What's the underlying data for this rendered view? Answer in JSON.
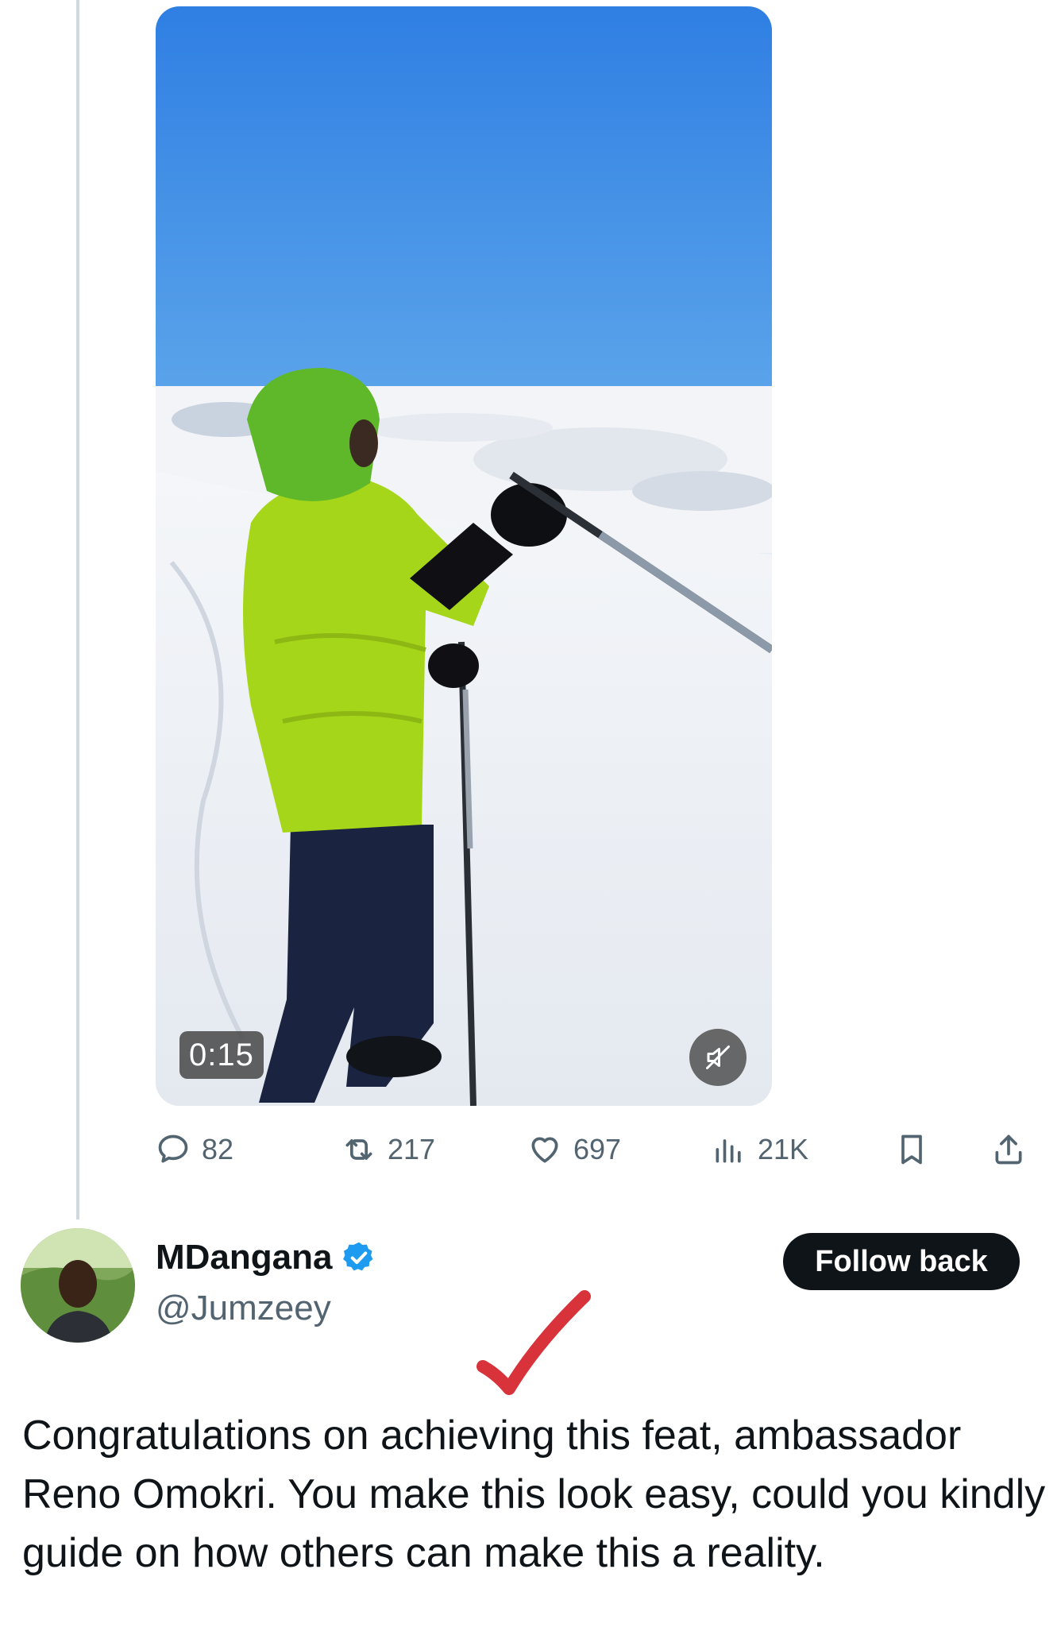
{
  "video": {
    "duration": "0:15"
  },
  "actions": {
    "replies": "82",
    "reposts": "217",
    "likes": "697",
    "views": "21K"
  },
  "reply": {
    "display_name": "MDangana",
    "handle": "@Jumzeey",
    "follow_label": "Follow back",
    "text": "Congratulations on achieving this feat, ambassador Reno Omokri. You make this look easy, could you kindly guide on how others can make this a reality."
  },
  "colors": {
    "verified_blue": "#1d9bf0",
    "action_gray": "#536471",
    "annotation_red": "#d8323b",
    "jacket_green": "#a6d61a"
  },
  "icons": [
    "reply-icon",
    "repost-icon",
    "like-icon",
    "views-icon",
    "bookmark-icon",
    "share-icon",
    "mute-icon",
    "verified-icon"
  ]
}
